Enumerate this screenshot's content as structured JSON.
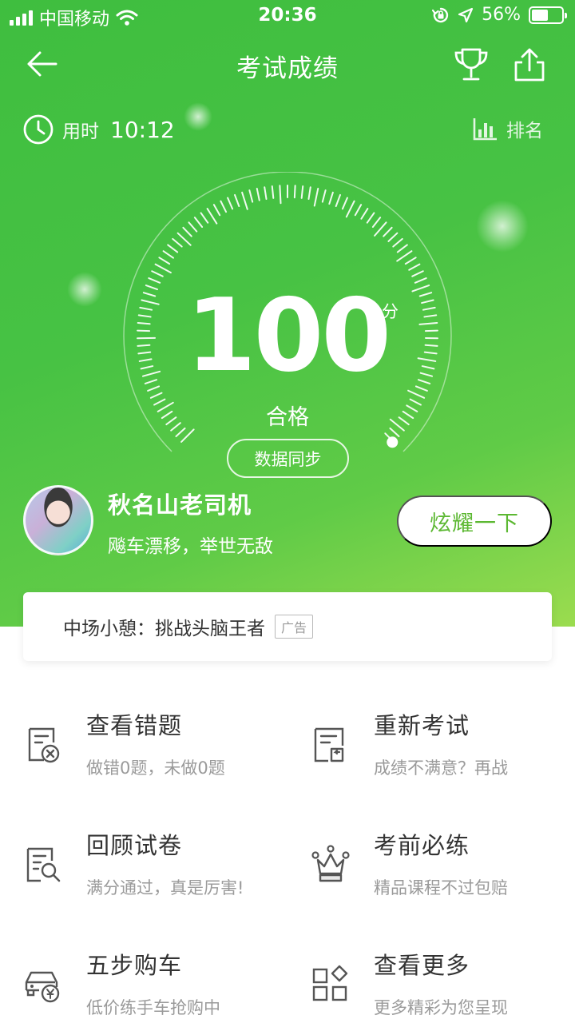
{
  "status_bar": {
    "carrier": "中国移动",
    "time": "20:36",
    "battery": "56%",
    "battery_level": 0.56
  },
  "nav": {
    "title": "考试成绩",
    "icons": [
      "back-arrow-icon",
      "trophy-icon",
      "share-icon"
    ]
  },
  "summary": {
    "time_label": "用时",
    "time_value": "10:12",
    "rank_label": "排名"
  },
  "score": {
    "value": "100",
    "unit": "分",
    "result": "合格",
    "sync_label": "数据同步"
  },
  "user": {
    "name": "秋名山老司机",
    "motto": "飚车漂移，举世无敌",
    "show_off_label": "炫耀一下"
  },
  "ad": {
    "text": "中场小憩：挑战头脑王者",
    "badge": "广告"
  },
  "features": [
    {
      "title": "查看错题",
      "subtitle": "做错0题，未做0题",
      "icon": "wrong-answers-icon"
    },
    {
      "title": "重新考试",
      "subtitle": "成绩不满意？再战",
      "icon": "retake-exam-icon"
    },
    {
      "title": "回顾试卷",
      "subtitle": "满分通过，真是厉害!",
      "icon": "review-paper-icon"
    },
    {
      "title": "考前必练",
      "subtitle": "精品课程不过包赔",
      "icon": "crown-icon"
    },
    {
      "title": "五步购车",
      "subtitle": "低价练手车抢购中",
      "icon": "car-purchase-icon"
    },
    {
      "title": "查看更多",
      "subtitle": "更多精彩为您呈现",
      "icon": "more-apps-icon"
    }
  ],
  "colors": {
    "hero_start": "#3fbe3f",
    "hero_end": "#9bdc4f",
    "accent_text": "#5cb832"
  }
}
